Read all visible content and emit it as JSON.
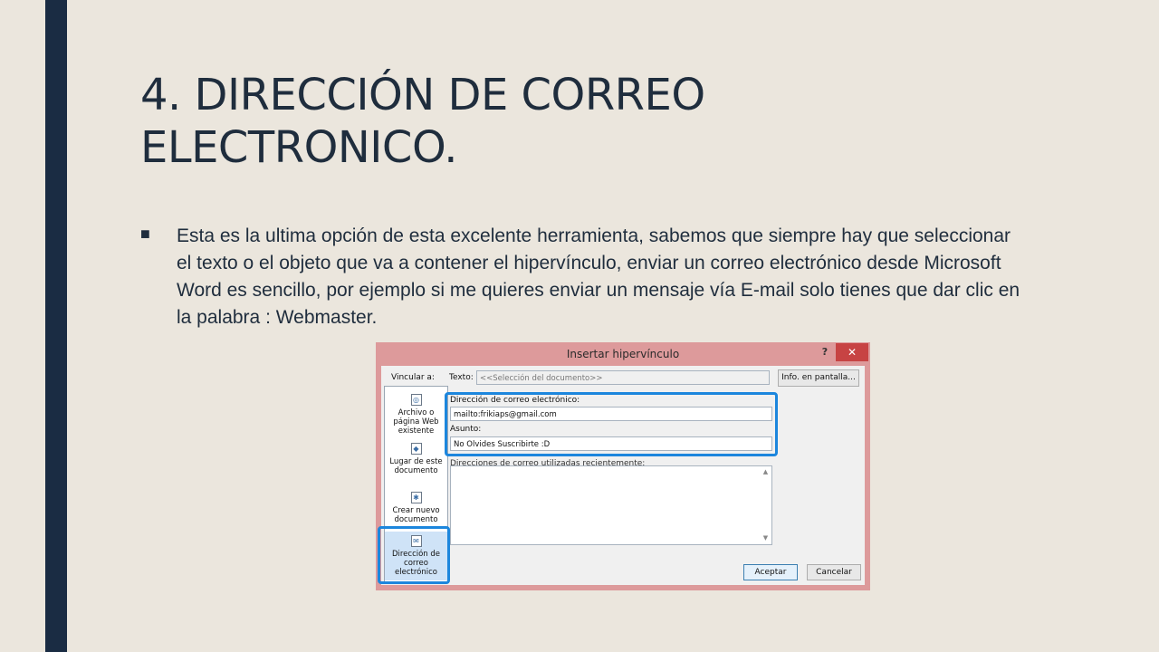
{
  "slide": {
    "title_line1": "4. DIRECCIÓN DE CORREO",
    "title_line2": "ELECTRONICO.",
    "bullet": "■",
    "body_text": "Esta es la ultima opción de esta excelente herramienta, sabemos que siempre hay que seleccionar el texto o el objeto que va a contener el hipervínculo, enviar un correo electrónico desde Microsoft Word es sencillo, por ejemplo si me quieres enviar un mensaje vía E-mail solo tienes que dar clic en la palabra : Webmaster."
  },
  "colors": {
    "background": "#ebe6dd",
    "side_bar": "#1a2c43",
    "text": "#1f2d3d",
    "highlight": "#1c86dd",
    "dialog_frame": "#dd9a9b",
    "close_button": "#c74343"
  },
  "dialog": {
    "title": "Insertar hipervínculo",
    "help": "?",
    "close": "✕",
    "link_to_label": "Vincular a:",
    "text_label": "Texto:",
    "text_value": "<<Selección del documento>>",
    "screen_tip_button": "Info. en pantalla...",
    "link_items": [
      {
        "label": "Archivo o página Web existente",
        "icon": "globe-page-icon"
      },
      {
        "label": "Lugar de este documento",
        "icon": "document-place-icon"
      },
      {
        "label": "Crear nuevo documento",
        "icon": "new-document-icon"
      },
      {
        "label": "Dirección de correo electrónico",
        "icon": "email-icon"
      }
    ],
    "email_label": "Dirección de correo electrónico:",
    "email_value": "mailto:frikiaps@gmail.com",
    "subject_label": "Asunto:",
    "subject_value": "No Olvides Suscribirte :D",
    "recent_label": "Direcciones de correo utilizadas recientemente:",
    "ok_button": "Aceptar",
    "cancel_button": "Cancelar"
  }
}
